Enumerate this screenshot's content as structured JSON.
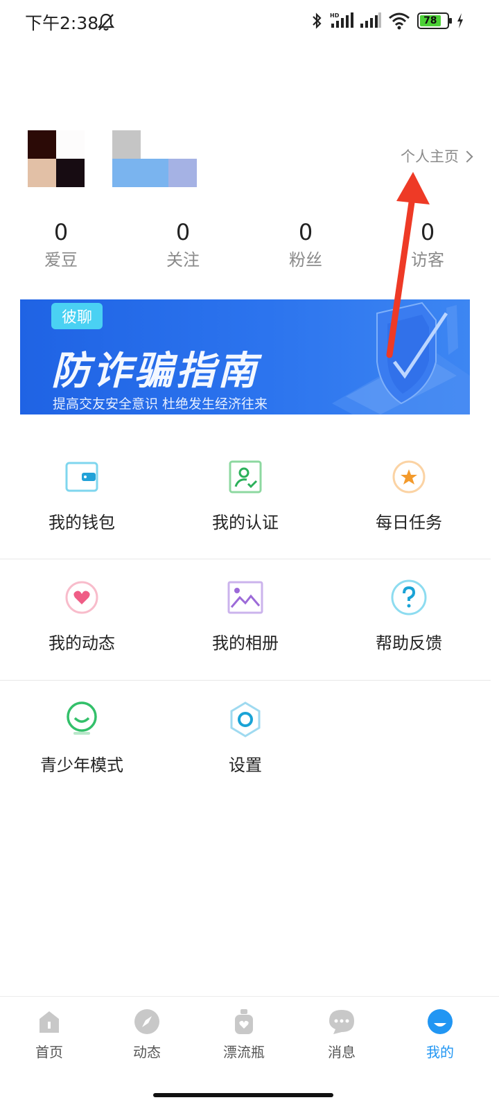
{
  "status_bar": {
    "time": "下午2:38",
    "battery": "78",
    "icons": [
      "mute-icon",
      "bluetooth-icon",
      "signal-hd-icon",
      "signal-icon",
      "wifi-icon",
      "battery-icon",
      "charging-icon"
    ]
  },
  "profile": {
    "homepage_link": "个人主页"
  },
  "stats": [
    {
      "value": "0",
      "label": "爱豆"
    },
    {
      "value": "0",
      "label": "关注"
    },
    {
      "value": "0",
      "label": "粉丝"
    },
    {
      "value": "0",
      "label": "访客"
    }
  ],
  "banner": {
    "tag": "彼聊",
    "title": "防诈骗指南",
    "subtitle": "提高交友安全意识 杜绝发生经济往来"
  },
  "menu": [
    {
      "label": "我的钱包",
      "icon": "wallet-icon"
    },
    {
      "label": "我的认证",
      "icon": "verified-user-icon"
    },
    {
      "label": "每日任务",
      "icon": "star-task-icon"
    },
    {
      "label": "我的动态",
      "icon": "heart-icon"
    },
    {
      "label": "我的相册",
      "icon": "album-icon"
    },
    {
      "label": "帮助反馈",
      "icon": "help-icon"
    },
    {
      "label": "青少年模式",
      "icon": "youth-mode-icon"
    },
    {
      "label": "设置",
      "icon": "settings-icon"
    }
  ],
  "tabs": [
    {
      "label": "首页",
      "icon": "home-icon",
      "active": false
    },
    {
      "label": "动态",
      "icon": "compass-icon",
      "active": false
    },
    {
      "label": "漂流瓶",
      "icon": "bottle-icon",
      "active": false
    },
    {
      "label": "消息",
      "icon": "message-icon",
      "active": false
    },
    {
      "label": "我的",
      "icon": "profile-icon",
      "active": true
    }
  ],
  "colors": {
    "accent": "#2196f3",
    "banner": "#2c74ee",
    "annotation_arrow": "#ee3a26"
  }
}
